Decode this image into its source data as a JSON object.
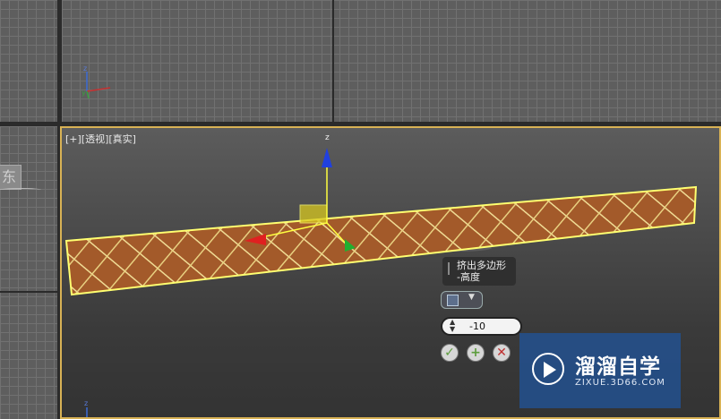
{
  "viewports": {
    "top_left": {
      "label": ""
    },
    "top_right": {
      "label": ""
    },
    "left": {
      "button_text": "东"
    },
    "perspective": {
      "label": "[+][透视][真实]"
    }
  },
  "gizmo": {
    "z_label": "z"
  },
  "axis_tripod": {
    "y_label": "y",
    "z_label": "z"
  },
  "caddy": {
    "title_line1": "挤出多边形",
    "title_line2": "-高度",
    "height_value": "-10",
    "ok_icon": "check-icon",
    "apply_icon": "plus-icon",
    "cancel_icon": "x-icon",
    "colors": {
      "ok": "#5c9c3c",
      "apply": "#5c9c3c",
      "cancel": "#c03030"
    }
  },
  "watermark": {
    "brand": "溜溜自学",
    "url": "ZIXUE.3D66.COM"
  },
  "colors": {
    "active_border": "#d8b255",
    "floor_fill": "#a35a2a",
    "floor_lines": "#e8d590"
  }
}
